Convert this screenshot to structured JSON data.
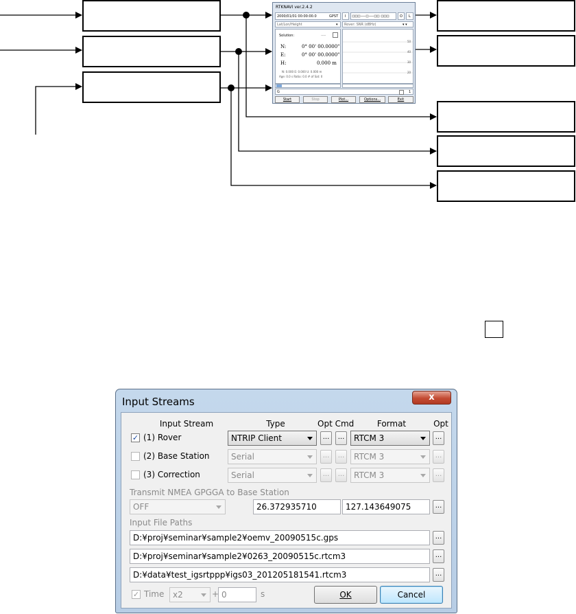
{
  "rtknavi": {
    "title": "RTKNAVI ver.2.4.2",
    "time": "2000/01/01 00:00:00.0",
    "time_sys": "GPST",
    "io_btn_left": "I",
    "io_btn_o": "O",
    "io_btn_l": "L",
    "mode": "Lat/Lon/Height",
    "plot_mode": "Rover: SNR (dBHz)",
    "solution_label": "Solution:",
    "solution_value": "----",
    "n_label": "N:",
    "n_value": "0° 00' 00.0000\"",
    "e_label": "E:",
    "e_value": "0° 00' 00.0000\"",
    "h_label": "H:",
    "h_value": "0.000 m",
    "std_line": "N: 0.000 E: 0.000 U: 0.000 m",
    "age_line": "Age: 0.0 s Ratio: 0.0 # of Sat: 0",
    "snr_ticks": [
      "50",
      "40",
      "30",
      "20"
    ],
    "bottom_left": "G",
    "bottom_right": "1",
    "buttons": {
      "start": "Start",
      "stop": "Stop",
      "plot": "Plot...",
      "options": "Options...",
      "exit": "Exit"
    }
  },
  "dialog": {
    "title": "Input Streams",
    "close_glyph": "x",
    "headers": {
      "stream": "Input Stream",
      "type": "Type",
      "opt_cmd": "Opt Cmd",
      "format": "Format",
      "opt": "Opt"
    },
    "streams": [
      {
        "label": "(1) Rover",
        "checked": true,
        "type": "NTRIP Client",
        "format": "RTCM 3"
      },
      {
        "label": "(2) Base Station",
        "checked": false,
        "type": "Serial",
        "format": "RTCM 3"
      },
      {
        "label": "(3) Correction",
        "checked": false,
        "type": "Serial",
        "format": "RTCM 3"
      }
    ],
    "dots": "...",
    "check_mark": "✓",
    "nmea_label": "Transmit NMEA GPGGA to Base Station",
    "nmea_mode": "OFF",
    "nmea_lat": "26.372935710",
    "nmea_lon": "127.143649075",
    "paths_label": "Input File Paths",
    "paths": [
      "D:¥proj¥seminar¥sample2¥oemv_20090515c.gps",
      "D:¥proj¥seminar¥sample2¥0263_20090515c.rtcm3",
      "D:¥data¥test_igsrtppp¥igs03_201205181541.rtcm3"
    ],
    "time_label": "Time",
    "speed": "x2",
    "plus": "+",
    "offset": "0",
    "unit": "s",
    "ok": "OK",
    "cancel": "Cancel"
  }
}
